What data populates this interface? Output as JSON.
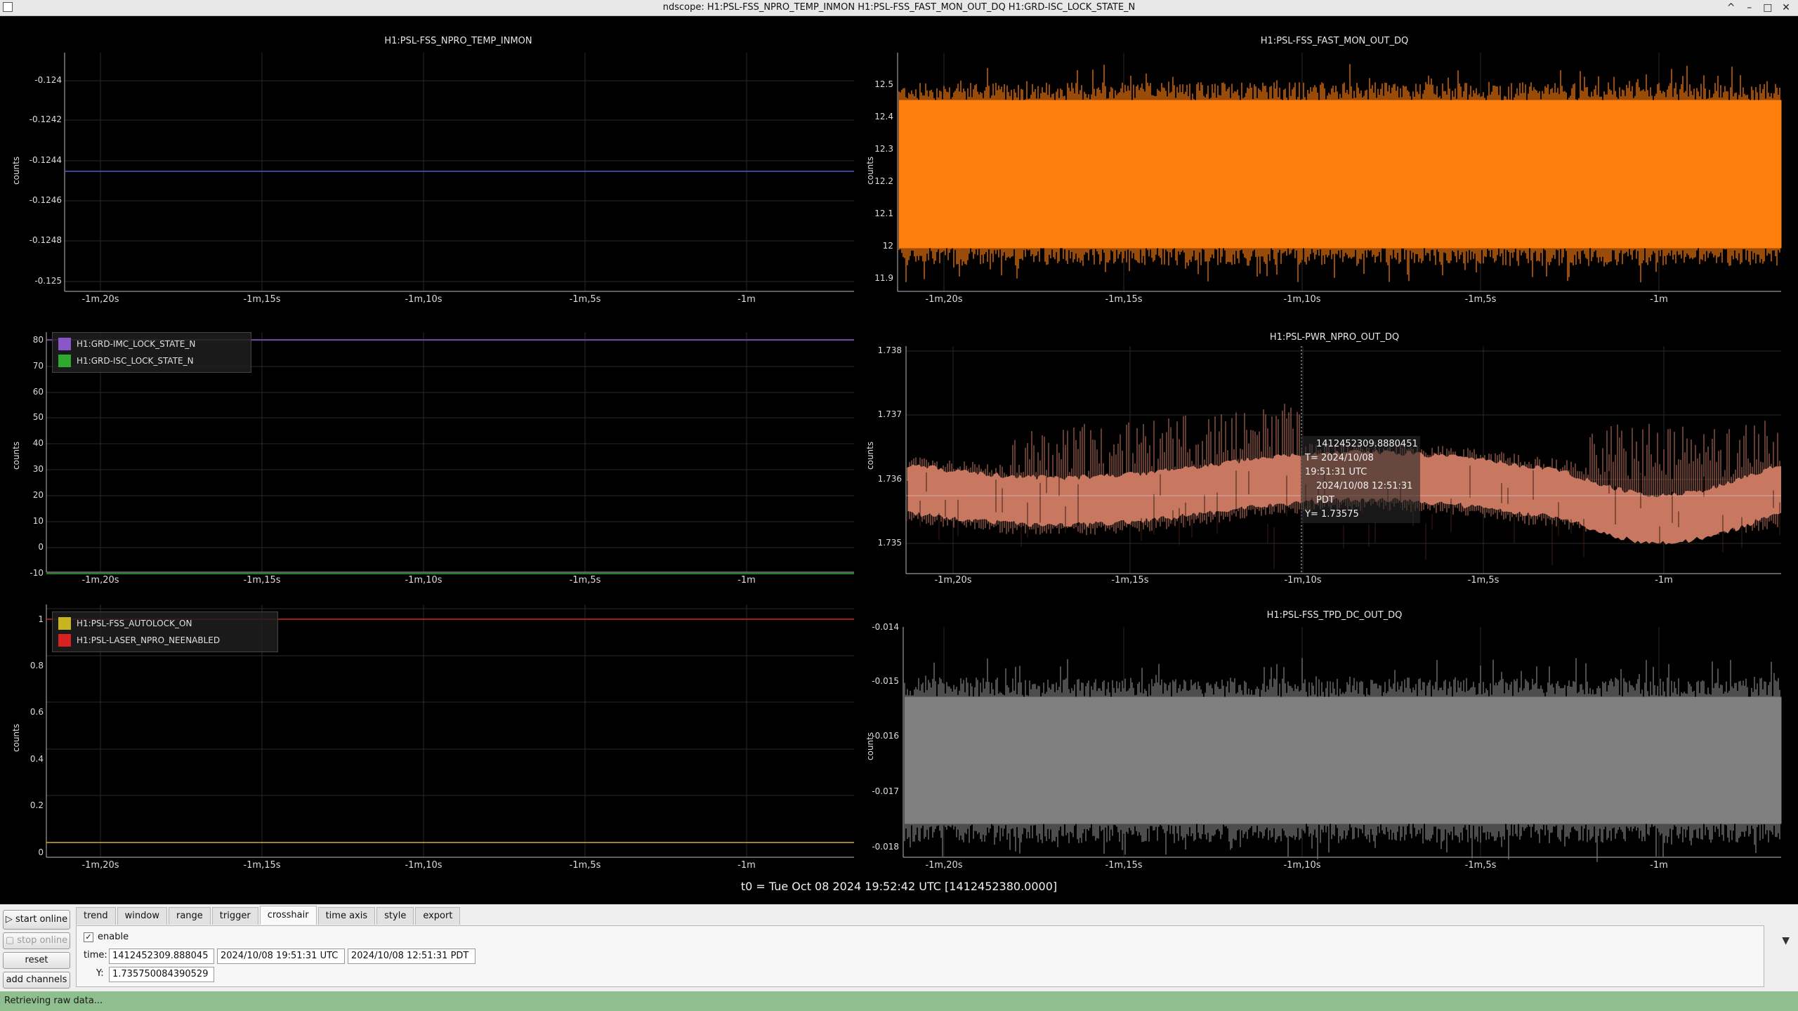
{
  "window": {
    "title": "ndscope: H1:PSL-FSS_NPRO_TEMP_INMON H1:PSL-FSS_FAST_MON_OUT_DQ H1:GRD-ISC_LOCK_STATE_N",
    "controls": [
      "^",
      "–",
      "□",
      "✕"
    ]
  },
  "plots": {
    "temp": {
      "title": "H1:PSL-FSS_NPRO_TEMP_INMON",
      "unit": "counts",
      "yticks": [
        "-0.124",
        "-0.1242",
        "-0.1244",
        "-0.1246",
        "-0.1248",
        "-0.125"
      ],
      "xticks": [
        "-1m,20s",
        "-1m,15s",
        "-1m,10s",
        "-1m,5s",
        "-1m"
      ],
      "color": "#4a5cc8"
    },
    "lock": {
      "unit": "counts",
      "yticks": [
        "80",
        "70",
        "60",
        "50",
        "40",
        "30",
        "20",
        "10",
        "0",
        "-10"
      ],
      "xticks": [
        "-1m,20s",
        "-1m,15s",
        "-1m,10s",
        "-1m,5s",
        "-1m"
      ],
      "legend": [
        {
          "label": "H1:GRD-IMC_LOCK_STATE_N",
          "color": "#8a55c8"
        },
        {
          "label": "H1:GRD-ISC_LOCK_STATE_N",
          "color": "#2ea82e"
        }
      ]
    },
    "autolock": {
      "unit": "counts",
      "yticks": [
        "1",
        "0.8",
        "0.6",
        "0.4",
        "0.2",
        "0"
      ],
      "xticks": [
        "-1m,20s",
        "-1m,15s",
        "-1m,10s",
        "-1m,5s",
        "-1m"
      ],
      "legend": [
        {
          "label": "H1:PSL-FSS_AUTOLOCK_ON",
          "color": "#c8b41e"
        },
        {
          "label": "H1:PSL-LASER_NPRO_NEENABLED",
          "color": "#d82222"
        }
      ]
    },
    "fast": {
      "title": "H1:PSL-FSS_FAST_MON_OUT_DQ",
      "unit": "counts",
      "yticks": [
        "12.5",
        "12.4",
        "12.3",
        "12.2",
        "12.1",
        "12",
        "11.9"
      ],
      "xticks": [
        "-1m,20s",
        "-1m,15s",
        "-1m,10s",
        "-1m,5s",
        "-1m"
      ],
      "color": "#ff7f0e"
    },
    "pwr": {
      "title": "H1:PSL-PWR_NPRO_OUT_DQ",
      "unit": "counts",
      "yticks": [
        "1.738",
        "1.737",
        "1.736",
        "1.735"
      ],
      "xticks": [
        "-1m,20s",
        "-1m,15s",
        "-1m,10s",
        "-1m,5s",
        "-1m"
      ],
      "color": "#c87860",
      "crosshair": {
        "gps": "1412452309.8880451",
        "utc": "T= 2024/10/08 19:51:31 UTC",
        "pdt": "2024/10/08 12:51:31 PDT",
        "y": "Y= 1.73575"
      }
    },
    "tpd": {
      "title": "H1:PSL-FSS_TPD_DC_OUT_DQ",
      "unit": "counts",
      "yticks": [
        "-0.014",
        "-0.015",
        "-0.016",
        "-0.017",
        "-0.018"
      ],
      "xticks": [
        "-1m,20s",
        "-1m,15s",
        "-1m,10s",
        "-1m,5s",
        "-1m"
      ],
      "color": "#808080"
    }
  },
  "t0": "t0 = Tue Oct 08 2024 19:52:42 UTC [1412452380.0000]",
  "buttons": {
    "start_online": "start online",
    "stop_online": "stop online",
    "reset": "reset",
    "add_channels": "add channels"
  },
  "tabs": [
    "trend",
    "window",
    "range",
    "trigger",
    "crosshair",
    "time axis",
    "style",
    "export"
  ],
  "active_tab": "crosshair",
  "crosshair_panel": {
    "enable_label": "enable",
    "enable_checked": true,
    "time_label": "time:",
    "time_gps": "1412452309.888045",
    "time_utc": "2024/10/08 19:51:31 UTC",
    "time_pdt": "2024/10/08 12:51:31 PDT",
    "y_label": "Y:",
    "y_value": "1.735750084390529"
  },
  "status": "Retrieving raw data..."
}
